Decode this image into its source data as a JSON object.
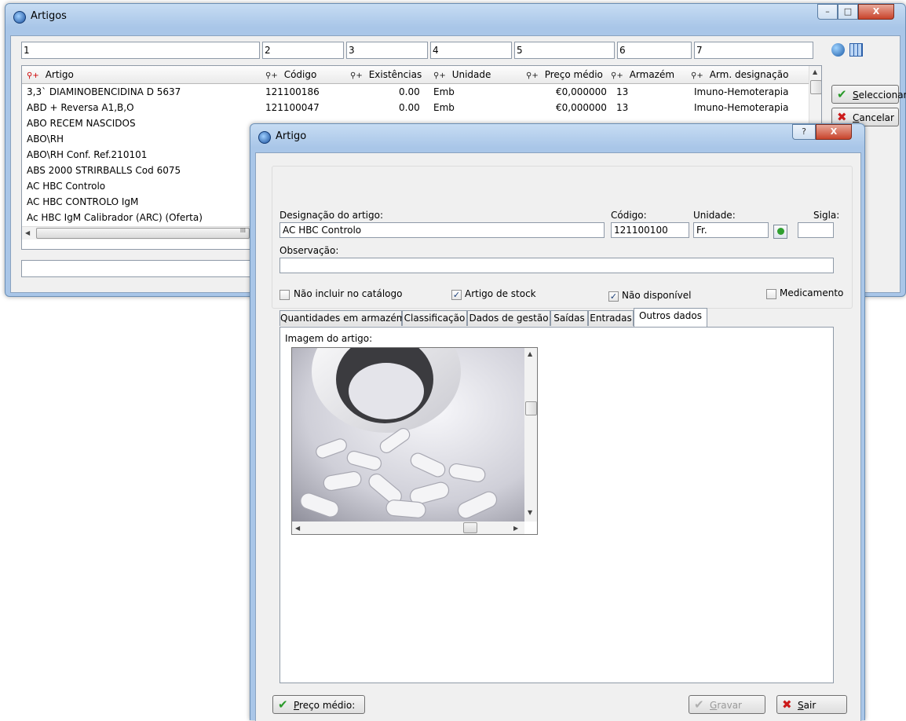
{
  "main_window": {
    "title": "Artigos",
    "controls": {
      "minimize": "–",
      "maximize": "□",
      "close": "X"
    },
    "filter_labels": [
      "1",
      "2",
      "3",
      "4",
      "5",
      "6",
      "7"
    ],
    "columns": [
      "Artigo",
      "Código",
      "Existências",
      "Unidade",
      "Preço médio",
      "Armazém",
      "Arm. designação"
    ],
    "rows": [
      {
        "artigo": "3,3` DIAMINOBENCIDINA D 5637",
        "codigo": "121100186",
        "existencias": "0.00",
        "unidade": "Emb",
        "preco": "€0,000000",
        "armazem": "13",
        "designacao": "Imuno-Hemoterapia"
      },
      {
        "artigo": "ABD + Reversa  A1,B,O",
        "codigo": "121100047",
        "existencias": "0.00",
        "unidade": "Emb",
        "preco": "€0,000000",
        "armazem": "13",
        "designacao": "Imuno-Hemoterapia"
      },
      {
        "artigo": "ABO RECEM NASCIDOS"
      },
      {
        "artigo": "ABO\\RH"
      },
      {
        "artigo": "ABO\\RH Conf. Ref.210101"
      },
      {
        "artigo": "ABS 2000 STRIRBALLS Cod 6075"
      },
      {
        "artigo": "AC HBC Controlo"
      },
      {
        "artigo": "AC HBC CONTROLO IgM"
      },
      {
        "artigo": "Ac HBC IgM Calibrador (ARC) (Oferta)"
      }
    ],
    "hscroll_grip": "III",
    "buttons": {
      "seleccionar": "Seleccionar",
      "cancelar": "Cancelar"
    }
  },
  "dialog": {
    "title": "Artigo",
    "controls": {
      "help": "?",
      "close": "X"
    },
    "fields": {
      "designacao_label": "Designação do artigo:",
      "designacao_value": "AC HBC Controlo",
      "codigo_label": "Código:",
      "codigo_value": "121100100",
      "unidade_label": "Unidade:",
      "unidade_value": "Fr.",
      "sigla_label": "Sigla:",
      "sigla_value": "",
      "observacao_label": "Observação:",
      "observacao_value": ""
    },
    "checkboxes": [
      {
        "label": "Não incluir no catálogo",
        "checked": false
      },
      {
        "label": "Artigo de stock",
        "checked": true
      },
      {
        "label": "Não disponível",
        "checked": true
      },
      {
        "label": "Medicamento",
        "checked": false
      }
    ],
    "tabs": [
      "Quantidades em armazém",
      "Classificação",
      "Dados de gestão",
      "Saídas",
      "Entradas",
      "Outros dados"
    ],
    "active_tab": "Outros dados",
    "image_label": "Imagem do artigo:",
    "buttons": {
      "preco_medio": "Preço médio:",
      "gravar": "Gravar",
      "sair": "Sair"
    }
  }
}
